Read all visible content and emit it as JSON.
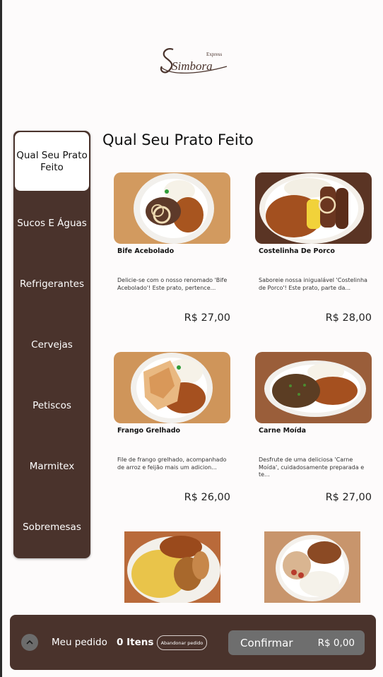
{
  "brand": {
    "express": "Express",
    "name": "Simbora"
  },
  "categories": [
    {
      "label": "Qual Seu Prato Feito",
      "active": true
    },
    {
      "label": "Sucos E Águas"
    },
    {
      "label": "Refrigerantes"
    },
    {
      "label": "Cervejas"
    },
    {
      "label": "Petiscos"
    },
    {
      "label": "Marmitex"
    },
    {
      "label": "Sobremesas"
    }
  ],
  "section": {
    "title": "Qual Seu Prato Feito"
  },
  "products": [
    {
      "name": "Bife Acebolado",
      "description": "Delicie-se com o nosso renomado 'Bife Acebolado'! Este prato, pertence...",
      "price": "R$ 27,00",
      "icon": "bife-acebolado-photo"
    },
    {
      "name": "Costelinha De Porco",
      "description": "Saboreie nossa inigualável 'Costelinha de Porco'! Este prato, parte da...",
      "price": "R$ 28,00",
      "icon": "costelinha-photo"
    },
    {
      "name": "Frango Grelhado",
      "description": "File de frango grelhado, acompanhado de arroz e feijão mais um adicion...",
      "price": "R$ 26,00",
      "icon": "frango-photo"
    },
    {
      "name": "Carne Moída",
      "description": "Desfrute de uma deliciosa 'Carne Moída', cuidadosamente preparada e te...",
      "price": "R$ 27,00",
      "icon": "carne-moida-photo"
    }
  ],
  "order": {
    "label": "Meu pedido",
    "items": "0 Itens",
    "abandon": "Abandonar pedido",
    "confirm": "Confirmar",
    "total": "R$ 0,00"
  },
  "colors": {
    "sidebar": "#4a332c",
    "confirm": "#6e6e6e",
    "background": "#fdfbfb"
  }
}
